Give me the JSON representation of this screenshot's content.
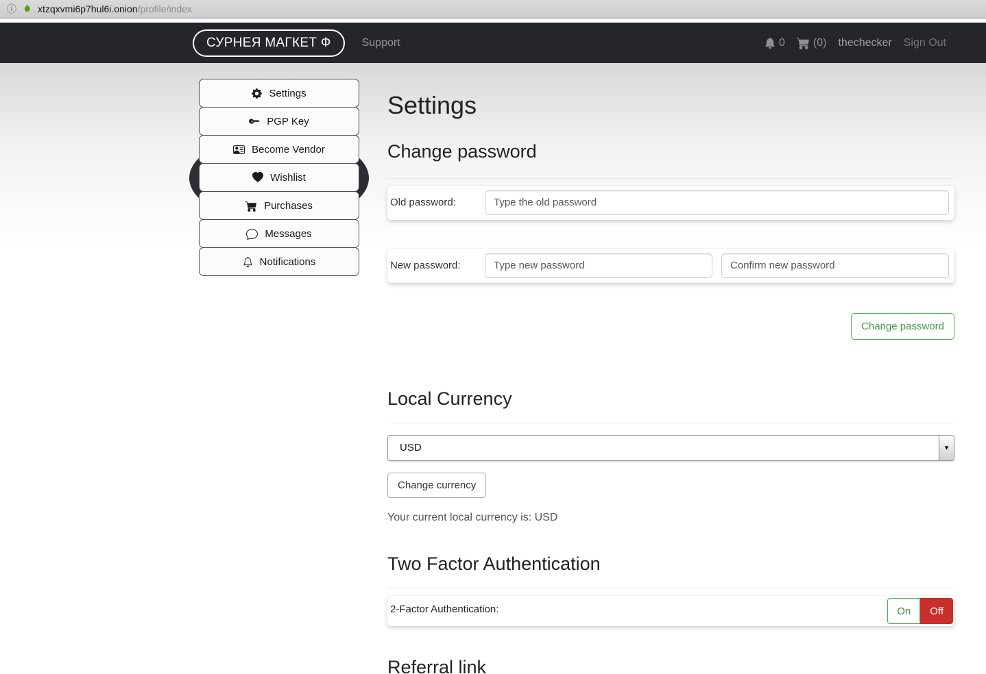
{
  "browser": {
    "url_host": "xtzqxvmi6p7hul6i.onion",
    "url_path": "/profile/index"
  },
  "navbar": {
    "brand": "СУРНЕЯ МАГКЕТ Ф",
    "support": "Support",
    "notification_count": "0",
    "cart_count": "(0)",
    "username": "thechecker",
    "sign_out": "Sign Out"
  },
  "sidebar": {
    "items": [
      {
        "label": "Settings",
        "icon": "gear-icon"
      },
      {
        "label": "PGP Key",
        "icon": "key-icon"
      },
      {
        "label": "Become Vendor",
        "icon": "id-card-icon"
      },
      {
        "label": "Wishlist",
        "icon": "heart-icon"
      },
      {
        "label": "Purchases",
        "icon": "cart-icon"
      },
      {
        "label": "Messages",
        "icon": "chat-icon"
      },
      {
        "label": "Notifications",
        "icon": "bell-icon"
      }
    ]
  },
  "main": {
    "title": "Settings",
    "change_password": {
      "heading": "Change password",
      "old_label": "Old password:",
      "old_placeholder": "Type the old password",
      "new_label": "New password:",
      "new_placeholder": "Type new password",
      "confirm_placeholder": "Confirm new password",
      "submit_label": "Change password"
    },
    "local_currency": {
      "heading": "Local Currency",
      "selected_option": "USD",
      "change_button": "Change currency",
      "note": "Your current local currency is: USD"
    },
    "two_factor": {
      "heading": "Two Factor Authentication",
      "label": "2-Factor Authentication:",
      "on_label": "On",
      "off_label": "Off"
    },
    "referral": {
      "heading": "Referral link"
    }
  },
  "colors": {
    "navbar_bg": "#24262b",
    "accent_green": "#4cae4c",
    "danger_red": "#c9302c",
    "onion_green": "#63991d"
  }
}
